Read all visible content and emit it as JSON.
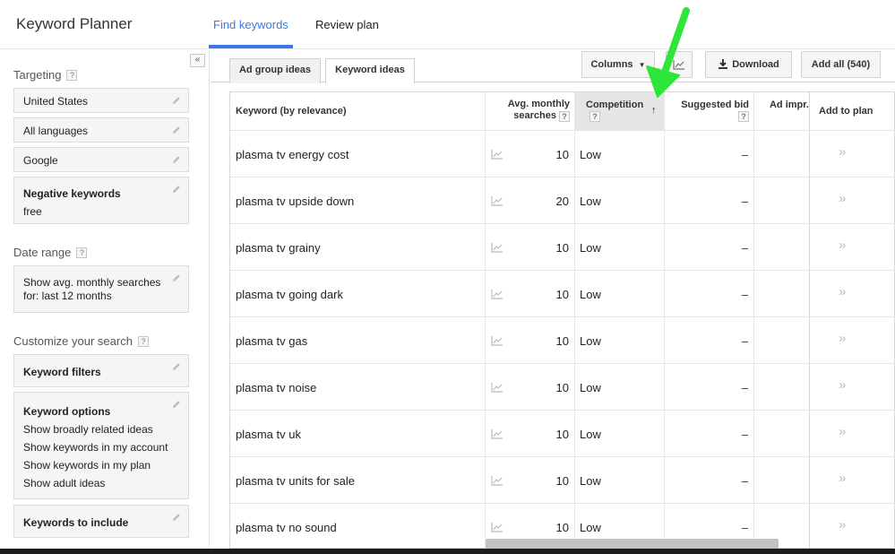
{
  "header": {
    "app_title": "Keyword Planner",
    "tabs": [
      "Find keywords",
      "Review plan"
    ],
    "active_tab": 0,
    "accent_color": "#3b78e7"
  },
  "sidebar": {
    "collapse_label": "«",
    "targeting_label": "Targeting",
    "targeting_items": [
      "United States",
      "All languages",
      "Google"
    ],
    "negative_keywords": {
      "title": "Negative keywords",
      "value": "free"
    },
    "date_range_label": "Date range",
    "date_range_value_line1": "Show avg. monthly searches",
    "date_range_value_line2": "for: last 12 months",
    "customize_label": "Customize your search",
    "keyword_filters": "Keyword filters",
    "keyword_options": {
      "title": "Keyword options",
      "lines": [
        "Show broadly related ideas",
        "Show keywords in my account",
        "Show keywords in my plan",
        "Show adult ideas"
      ]
    },
    "keywords_to_include": "Keywords to include",
    "help_mark": "?"
  },
  "main": {
    "subtabs": [
      "Ad group ideas",
      "Keyword ideas"
    ],
    "active_subtab": 1,
    "toolbar": {
      "columns_label": "Columns",
      "download_label": "Download",
      "add_all_label": "Add all (540)"
    },
    "columns": {
      "keyword": "Keyword (by relevance)",
      "avg_line1": "Avg. monthly",
      "avg_line2": "searches",
      "competition": "Competition",
      "suggested_bid": "Suggested bid",
      "ad_impr": "Ad impr.",
      "add_to_plan": "Add to plan"
    },
    "rows": [
      {
        "keyword": "plasma tv energy cost",
        "searches": "10",
        "competition": "Low",
        "bid": "–"
      },
      {
        "keyword": "plasma tv upside down",
        "searches": "20",
        "competition": "Low",
        "bid": "–"
      },
      {
        "keyword": "plasma tv grainy",
        "searches": "10",
        "competition": "Low",
        "bid": "–"
      },
      {
        "keyword": "plasma tv going dark",
        "searches": "10",
        "competition": "Low",
        "bid": "–"
      },
      {
        "keyword": "plasma tv gas",
        "searches": "10",
        "competition": "Low",
        "bid": "–"
      },
      {
        "keyword": "plasma tv noise",
        "searches": "10",
        "competition": "Low",
        "bid": "–"
      },
      {
        "keyword": "plasma tv uk",
        "searches": "10",
        "competition": "Low",
        "bid": "–"
      },
      {
        "keyword": "plasma tv units for sale",
        "searches": "10",
        "competition": "Low",
        "bid": "–"
      },
      {
        "keyword": "plasma tv no sound",
        "searches": "10",
        "competition": "Low",
        "bid": "–"
      }
    ],
    "add_glyph": "»",
    "sort_glyph": "↑",
    "annotation_arrow_color": "#2ee63a"
  }
}
